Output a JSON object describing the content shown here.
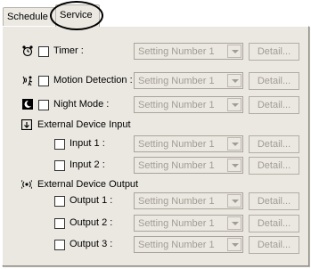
{
  "tabs": [
    {
      "label": "Schedule"
    },
    {
      "label": "Service"
    }
  ],
  "rows": [
    {
      "label": "Timer :",
      "select": "Setting Number 1",
      "button": "Detail..."
    },
    {
      "label": "Motion Detection :",
      "select": "Setting Number 1",
      "button": "Detail..."
    },
    {
      "label": "Night Mode :",
      "select": "Setting Number 1",
      "button": "Detail..."
    }
  ],
  "input_section": {
    "title": "External Device Input",
    "rows": [
      {
        "label": "Input 1 :",
        "select": "Setting Number 1",
        "button": "Detail..."
      },
      {
        "label": "Input 2 :",
        "select": "Setting Number 1",
        "button": "Detail..."
      }
    ]
  },
  "output_section": {
    "title": "External Device Output",
    "rows": [
      {
        "label": "Output 1 :",
        "select": "Setting Number 1",
        "button": "Detail..."
      },
      {
        "label": "Output 2 :",
        "select": "Setting Number 1",
        "button": "Detail..."
      },
      {
        "label": "Output 3 :",
        "select": "Setting Number 1",
        "button": "Detail..."
      }
    ]
  },
  "colors": {
    "panel": "#ebe8e1",
    "disabled_text": "#a19d95",
    "highlight_circle": "#000000"
  }
}
